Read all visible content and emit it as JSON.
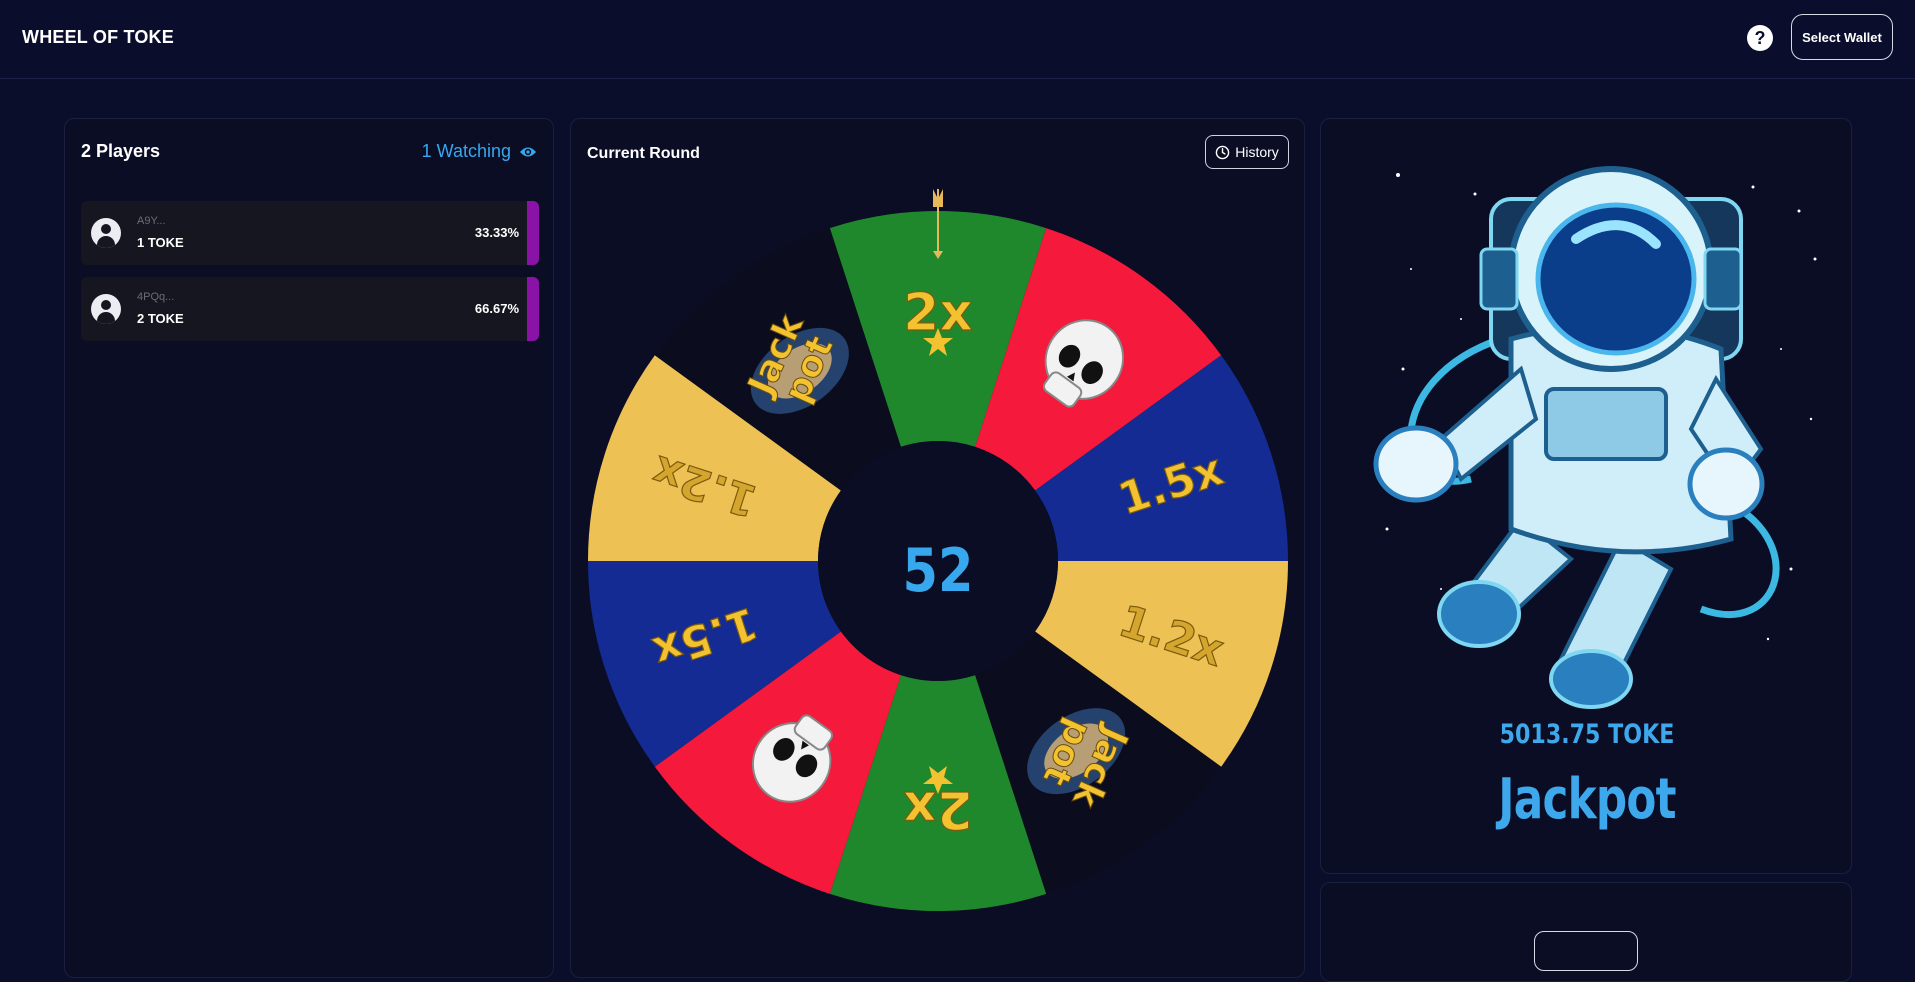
{
  "header": {
    "title": "WHEEL OF TOKE",
    "help_label": "?",
    "wallet_label": "Select Wallet"
  },
  "players": {
    "count_label": "2 Players",
    "watching_label": "1 Watching",
    "list": [
      {
        "address": "A9Y...",
        "amount": "1 TOKE",
        "percent": "33.33%"
      },
      {
        "address": "4PQq...",
        "amount": "2 TOKE",
        "percent": "66.67%"
      }
    ]
  },
  "round": {
    "title": "Current Round",
    "history_label": "History",
    "countdown": "52",
    "segments": [
      {
        "label": "2x",
        "color": "#20882c",
        "kind": "star"
      },
      {
        "label": "",
        "color": "#f5193b",
        "kind": "skull"
      },
      {
        "label": "1.5x",
        "color": "#142b93",
        "kind": "text"
      },
      {
        "label": "1.2x",
        "color": "#eec154",
        "kind": "text"
      },
      {
        "label": "Jack pot",
        "color": "#0b0d1e",
        "kind": "jackpot"
      },
      {
        "label": "2x",
        "color": "#20882c",
        "kind": "star"
      },
      {
        "label": "",
        "color": "#f5193b",
        "kind": "skull"
      },
      {
        "label": "1.5x",
        "color": "#142b93",
        "kind": "text"
      },
      {
        "label": "1.2x",
        "color": "#eec154",
        "kind": "text"
      },
      {
        "label": "Jack pot",
        "color": "#0b0d1e",
        "kind": "jackpot"
      }
    ]
  },
  "jackpot": {
    "amount": "5013.75 TOKE",
    "label": "Jackpot",
    "image": "astronaut-illustration"
  },
  "colors": {
    "background": "#0b0e2b",
    "accent_blue": "#37a7ee",
    "player_bar": "#8a12a6",
    "gold": "#f2c230"
  }
}
